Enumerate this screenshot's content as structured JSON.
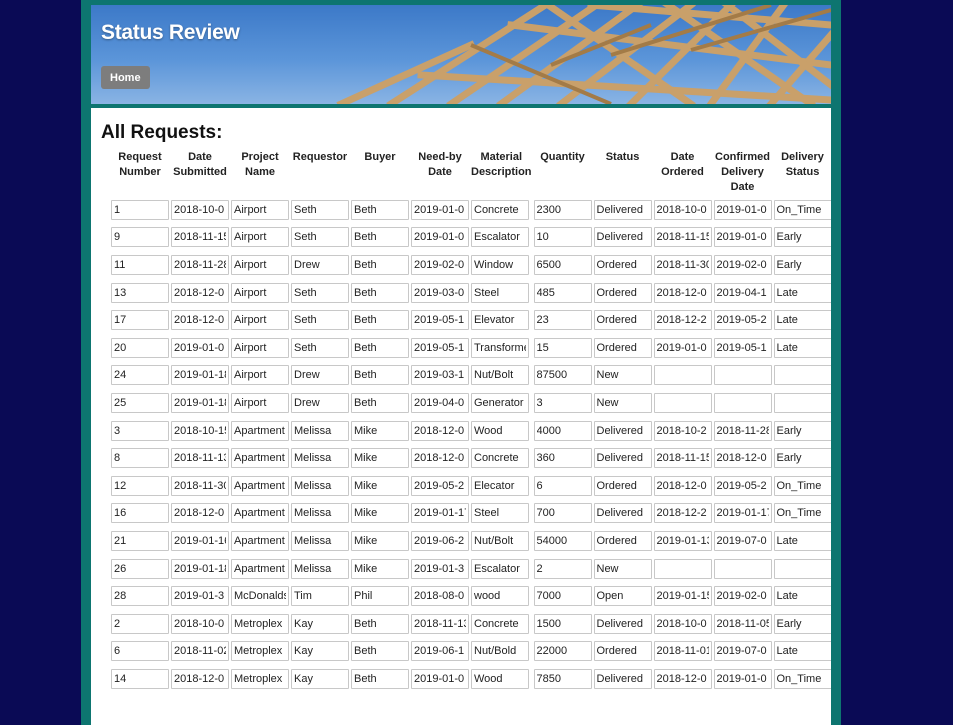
{
  "header": {
    "title": "Status Review",
    "home_label": "Home"
  },
  "main": {
    "heading": "All Requests:",
    "columns": [
      "Request Number",
      "Date Submitted",
      "Project Name",
      "Requestor",
      "Buyer",
      "Need-by Date",
      "Material Description",
      "Quantity",
      "Status",
      "Date Ordered",
      "Confirmed Delivery Date",
      "Delivery Status"
    ],
    "rows": [
      [
        "1",
        "2018-10-0",
        "Airport",
        "Seth",
        "Beth",
        "2019-01-0",
        "Concrete",
        "2300",
        "Delivered",
        "2018-10-0",
        "2019-01-0",
        "On_Time"
      ],
      [
        "9",
        "2018-11-1‍5",
        "Airport",
        "Seth",
        "Beth",
        "2019-01-0",
        "Escalator",
        "10",
        "Delivered",
        "2018-11-1‍5",
        "2019-01-0",
        "Early"
      ],
      [
        "11",
        "2018-11-2‍8",
        "Airport",
        "Drew",
        "Beth",
        "2019-02-0",
        "Window",
        "6500",
        "Ordered",
        "2018-11-3‍0",
        "2019-02-0",
        "Early"
      ],
      [
        "13",
        "2018-12-0",
        "Airport",
        "Seth",
        "Beth",
        "2019-03-0",
        "Steel",
        "485",
        "Ordered",
        "2018-12-0",
        "2019-04-1",
        "Late"
      ],
      [
        "17",
        "2018-12-0",
        "Airport",
        "Seth",
        "Beth",
        "2019-05-1",
        "Elevator",
        "23",
        "Ordered",
        "2018-12-2",
        "2019-05-2",
        "Late"
      ],
      [
        "20",
        "2019-01-0",
        "Airport",
        "Seth",
        "Beth",
        "2019-05-1",
        "Transforme",
        "15",
        "Ordered",
        "2019-01-0",
        "2019-05-1",
        "Late"
      ],
      [
        "24",
        "2019-01-1‍8",
        "Airport",
        "Drew",
        "Beth",
        "2019-03-1",
        "Nut/Bolt",
        "87500",
        "New",
        "",
        "",
        ""
      ],
      [
        "25",
        "2019-01-1‍8",
        "Airport",
        "Drew",
        "Beth",
        "2019-04-0",
        "Generator",
        "3",
        "New",
        "",
        "",
        ""
      ],
      [
        "3",
        "2018-10-1‍5",
        "Apartment",
        "Melissa",
        "Mike",
        "2018-12-0",
        "Wood",
        "4000",
        "Delivered",
        "2018-10-2",
        "2018-11-2‍8",
        "Early"
      ],
      [
        "8",
        "2018-11-1‍3",
        "Apartment",
        "Melissa",
        "Mike",
        "2018-12-0",
        "Concrete",
        "360",
        "Delivered",
        "2018-11-1‍5",
        "2018-12-0",
        "Early"
      ],
      [
        "12",
        "2018-11-3‍0",
        "Apartment",
        "Melissa",
        "Mike",
        "2019-05-2",
        "Elecator",
        "6",
        "Ordered",
        "2018-12-0",
        "2019-05-2",
        "On_Time"
      ],
      [
        "16",
        "2018-12-0",
        "Apartment",
        "Melissa",
        "Mike",
        "2019-01-1‍7",
        "Steel",
        "700",
        "Delivered",
        "2018-12-2",
        "2019-01-1‍7",
        "On_Time"
      ],
      [
        "21",
        "2019-01-1‍6",
        "Apartment",
        "Melissa",
        "Mike",
        "2019-06-2",
        "Nut/Bolt",
        "54000",
        "Ordered",
        "2019-01-1‍3",
        "2019-07-0",
        "Late"
      ],
      [
        "26",
        "2019-01-1‍8",
        "Apartment",
        "Melissa",
        "Mike",
        "2019-01-3",
        "Escalator",
        "2",
        "New",
        "",
        "",
        ""
      ],
      [
        "28",
        "2019-01-3",
        "McDonalds",
        "Tim",
        "Phil",
        "2018-08-0",
        "wood",
        "7000",
        "Open",
        "2019-01-1‍5",
        "2019-02-0",
        "Late"
      ],
      [
        "2",
        "2018-10-0",
        "Metroplex",
        "Kay",
        "Beth",
        "2018-11-1‍3",
        "Concrete",
        "1500",
        "Delivered",
        "2018-10-0",
        "2018-11-0‍5",
        "Early"
      ],
      [
        "6",
        "2018-11-0‍2",
        "Metroplex",
        "Kay",
        "Beth",
        "2019-06-1",
        "Nut/Bold",
        "22000",
        "Ordered",
        "2018-11-0‍1",
        "2019-07-0",
        "Late"
      ],
      [
        "14",
        "2018-12-0",
        "Metroplex",
        "Kay",
        "Beth",
        "2019-01-0",
        "Wood",
        "7850",
        "Delivered",
        "2018-12-0",
        "2019-01-0",
        "On_Time"
      ]
    ]
  }
}
